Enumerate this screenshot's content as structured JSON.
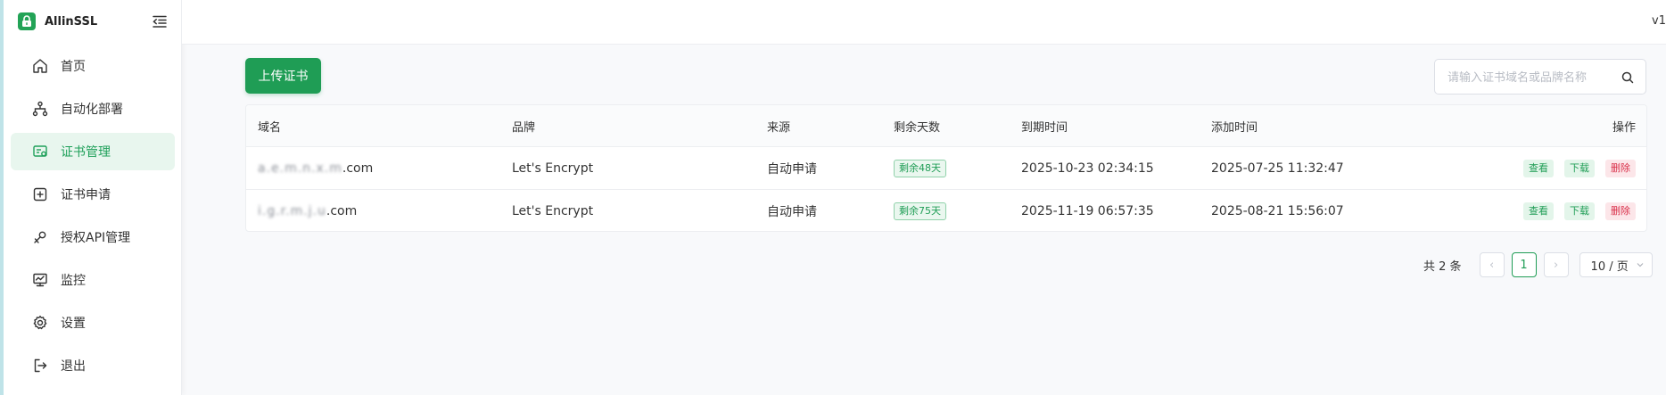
{
  "app": {
    "name": "AllinSSL",
    "version": "v1"
  },
  "sidebar": {
    "items": [
      {
        "label": "首页",
        "icon": "home-icon",
        "active": false
      },
      {
        "label": "自动化部署",
        "icon": "workflow-icon",
        "active": false
      },
      {
        "label": "证书管理",
        "icon": "certificate-icon",
        "active": true
      },
      {
        "label": "证书申请",
        "icon": "add-square-icon",
        "active": false
      },
      {
        "label": "授权API管理",
        "icon": "api-key-icon",
        "active": false
      },
      {
        "label": "监控",
        "icon": "monitor-icon",
        "active": false
      },
      {
        "label": "设置",
        "icon": "gear-icon",
        "active": false
      },
      {
        "label": "退出",
        "icon": "logout-icon",
        "active": false
      }
    ]
  },
  "toolbar": {
    "upload_label": "上传证书",
    "search_placeholder": "请输入证书域名或品牌名称"
  },
  "table": {
    "columns": [
      "域名",
      "品牌",
      "来源",
      "剩余天数",
      "到期时间",
      "添加时间",
      "操作"
    ],
    "rows": [
      {
        "domain_blur": "a.e.m.n.x.m",
        "domain_suffix": ".com",
        "brand": "Let's Encrypt",
        "source": "自动申请",
        "days": "剩余48天",
        "expire": "2025-10-23 02:34:15",
        "added": "2025-07-25 11:32:47"
      },
      {
        "domain_blur": "i.g.r.m.j.u",
        "domain_suffix": ".com",
        "brand": "Let's Encrypt",
        "source": "自动申请",
        "days": "剩余75天",
        "expire": "2025-11-19 06:57:35",
        "added": "2025-08-21 15:56:07"
      }
    ],
    "actions": {
      "view": "查看",
      "download": "下载",
      "delete": "删除"
    }
  },
  "pagination": {
    "total": "共 2 条",
    "current_page": "1",
    "prev": "‹",
    "next": "›",
    "page_size": "10 / 页"
  },
  "colors": {
    "accent": "#1f9d55",
    "danger": "#d9304a"
  }
}
